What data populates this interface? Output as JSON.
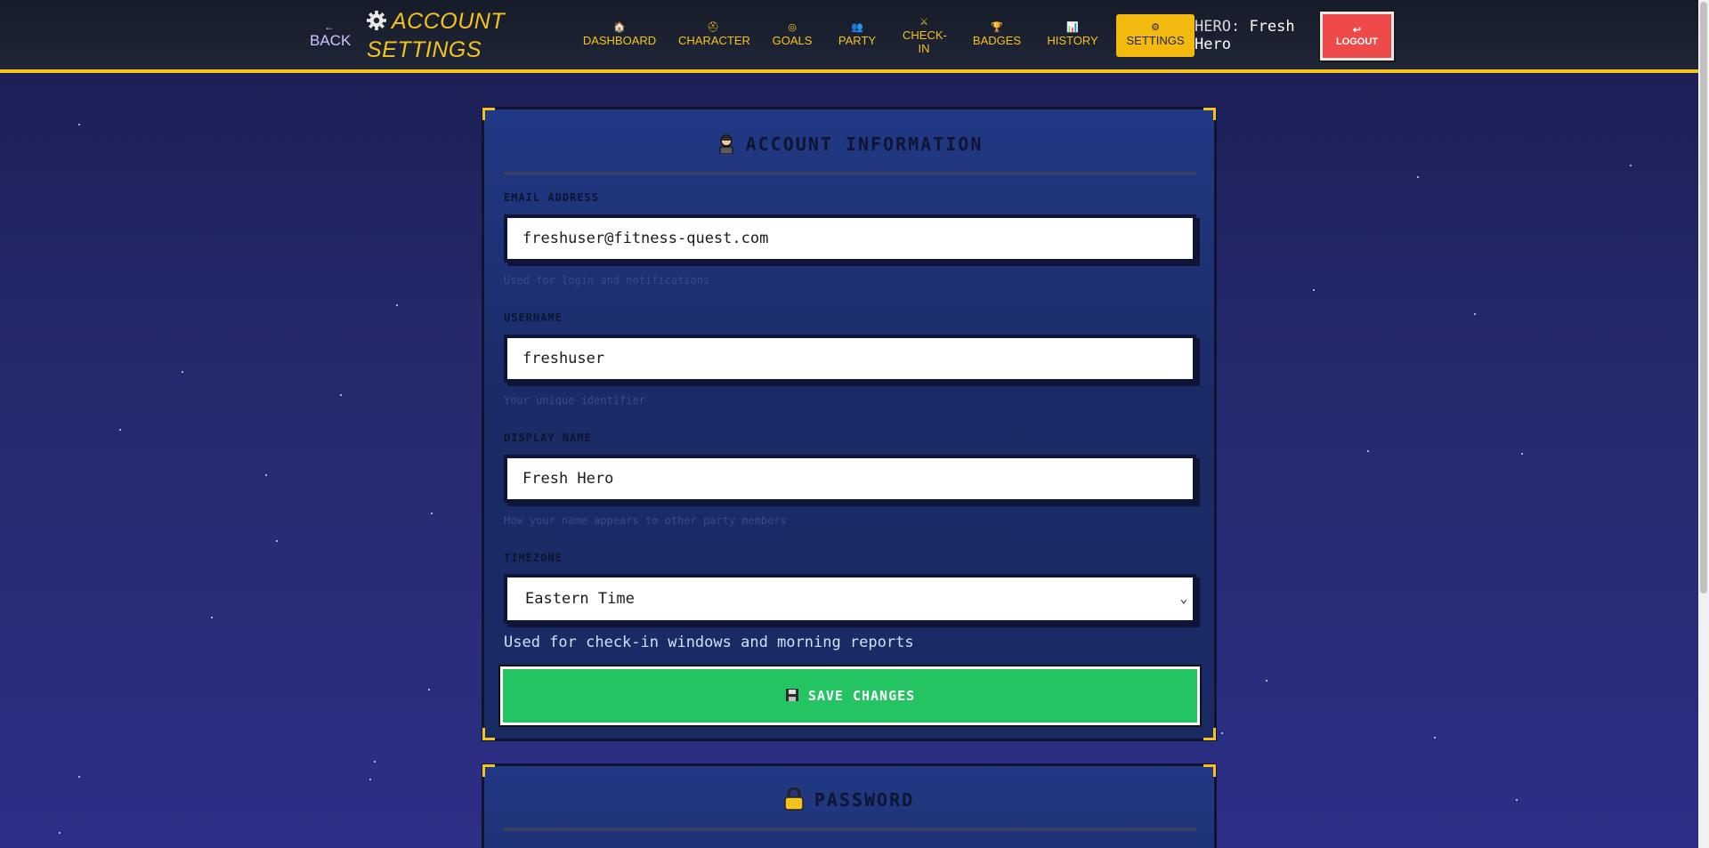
{
  "header": {
    "back_label": "BACK",
    "title": "ACCOUNT SETTINGS",
    "nav": [
      {
        "label": "DASHBOARD",
        "icon": "home-icon"
      },
      {
        "label": "CHARACTER",
        "icon": "hat-icon"
      },
      {
        "label": "GOALS",
        "icon": "target-icon"
      },
      {
        "label": "PARTY",
        "icon": "party-icon"
      },
      {
        "label": "CHECK-IN",
        "icon": "swords-icon"
      },
      {
        "label": "BADGES",
        "icon": "trophy-icon"
      },
      {
        "label": "HISTORY",
        "icon": "chart-icon"
      },
      {
        "label": "SETTINGS",
        "icon": "gear-icon",
        "active": true
      }
    ],
    "hero_label": "HERO:",
    "hero_name": "Fresh Hero",
    "logout_label": "LOGOUT"
  },
  "account": {
    "title": "ACCOUNT INFORMATION",
    "email_label": "EMAIL ADDRESS",
    "email_value": "freshuser@fitness-quest.com",
    "email_hint": "Used for login and notifications",
    "username_label": "USERNAME",
    "username_value": "freshuser",
    "username_hint": "Your unique identifier",
    "display_label": "DISPLAY NAME",
    "display_value": "Fresh Hero",
    "display_hint": "How your name appears to other party members",
    "timezone_label": "TIMEZONE",
    "timezone_value": "Eastern Time",
    "timezone_hint": "Used for check-in windows and morning reports",
    "save_label": "SAVE CHANGES"
  },
  "password": {
    "title": "PASSWORD"
  },
  "colors": {
    "accent": "#f6c31c",
    "logout": "#ef4a4a",
    "save": "#23c461",
    "card": "#213985"
  }
}
